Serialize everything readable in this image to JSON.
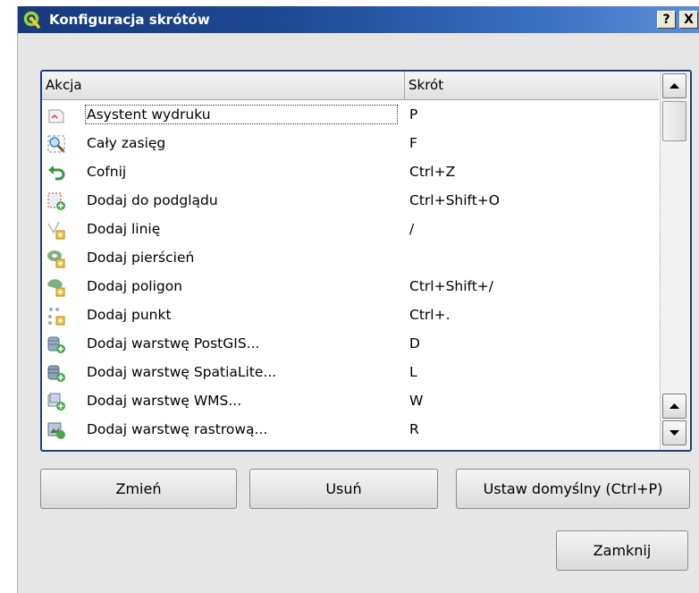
{
  "window": {
    "title": "Konfiguracja skrótów",
    "help_button": "?",
    "close_button": "X"
  },
  "table": {
    "columns": [
      "Akcja",
      "Skrót"
    ],
    "rows": [
      {
        "action": "Asystent wydruku",
        "shortcut": "P",
        "icon": "print-composer-icon"
      },
      {
        "action": "Cały zasięg",
        "shortcut": "F",
        "icon": "zoom-full-icon"
      },
      {
        "action": "Cofnij",
        "shortcut": "Ctrl+Z",
        "icon": "undo-icon"
      },
      {
        "action": "Dodaj do podglądu",
        "shortcut": "Ctrl+Shift+O",
        "icon": "add-to-overview-icon"
      },
      {
        "action": "Dodaj linię",
        "shortcut": "/",
        "icon": "add-line-icon"
      },
      {
        "action": "Dodaj pierścień",
        "shortcut": "",
        "icon": "add-ring-icon"
      },
      {
        "action": "Dodaj poligon",
        "shortcut": "Ctrl+Shift+/",
        "icon": "add-polygon-icon"
      },
      {
        "action": "Dodaj punkt",
        "shortcut": "Ctrl+.",
        "icon": "add-point-icon"
      },
      {
        "action": "Dodaj warstwę PostGIS...",
        "shortcut": "D",
        "icon": "add-postgis-layer-icon"
      },
      {
        "action": "Dodaj warstwę SpatiaLite...",
        "shortcut": "L",
        "icon": "add-spatialite-layer-icon"
      },
      {
        "action": "Dodaj warstwę WMS...",
        "shortcut": "W",
        "icon": "add-wms-layer-icon"
      },
      {
        "action": "Dodaj warstwę rastrową...",
        "shortcut": "R",
        "icon": "add-raster-layer-icon"
      }
    ]
  },
  "buttons": {
    "change": "Zmień",
    "remove": "Usuń",
    "set_default": "Ustaw domyślny (Ctrl+P)",
    "close": "Zamknij"
  }
}
